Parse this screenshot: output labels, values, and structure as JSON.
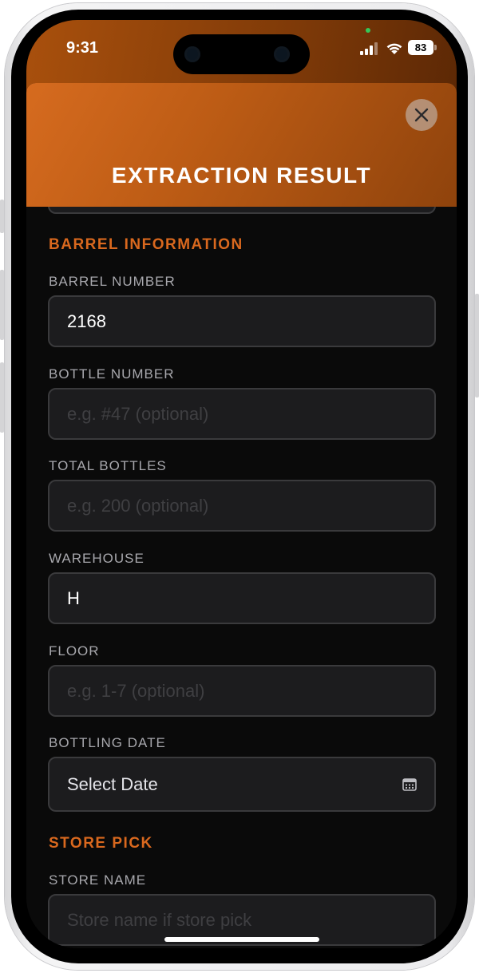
{
  "status_bar": {
    "time": "9:31",
    "battery": "83"
  },
  "sheet": {
    "title": "EXTRACTION RESULT",
    "close_icon": "close-icon"
  },
  "barrel_section": {
    "title": "BARREL INFORMATION",
    "barrel_number": {
      "label": "BARREL NUMBER",
      "value": "2168"
    },
    "bottle_number": {
      "label": "BOTTLE NUMBER",
      "placeholder": "e.g. #47 (optional)"
    },
    "total_bottles": {
      "label": "TOTAL BOTTLES",
      "placeholder": "e.g. 200 (optional)"
    },
    "warehouse": {
      "label": "WAREHOUSE",
      "value": "H"
    },
    "floor": {
      "label": "FLOOR",
      "placeholder": "e.g. 1-7 (optional)"
    },
    "bottling_date": {
      "label": "BOTTLING DATE",
      "value": "Select Date",
      "icon": "calendar-icon"
    }
  },
  "store_section": {
    "title": "STORE PICK",
    "store_name": {
      "label": "STORE NAME",
      "placeholder": "Store name if store pick"
    }
  },
  "colors": {
    "accent": "#d9681e",
    "field_bg": "#1c1c1e",
    "field_border": "#3a3a3c",
    "background": "#0a0a0a"
  }
}
